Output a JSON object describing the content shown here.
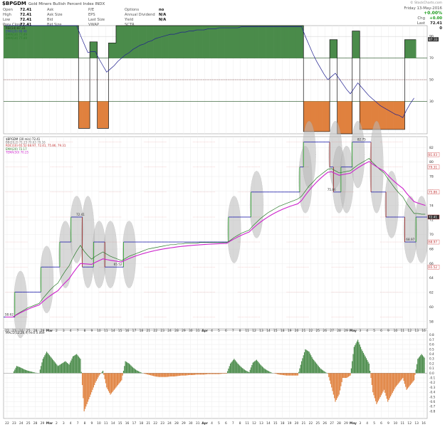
{
  "header": {
    "symbol": "$BPGDM",
    "name": "Gold Miners Bullish Percent Index  INDX",
    "copyright": "© StockCharts.com",
    "date": "Friday 13-May-2016",
    "change_pct": "+0.00%",
    "col1": [
      {
        "k": "Open",
        "v": "72.41"
      },
      {
        "k": "High",
        "v": "72.41"
      },
      {
        "k": "Low",
        "v": "72.41"
      },
      {
        "k": "Prev Close",
        "v": "72.41"
      }
    ],
    "col2": [
      {
        "k": "Ask",
        "v": ""
      },
      {
        "k": "Ask Size",
        "v": ""
      },
      {
        "k": "Bid",
        "v": ""
      },
      {
        "k": "Bid Size",
        "v": ""
      }
    ],
    "col3": [
      {
        "k": "P/E",
        "v": ""
      },
      {
        "k": "EPS",
        "v": ""
      },
      {
        "k": "Last Size",
        "v": ""
      },
      {
        "k": "VWAP",
        "v": ""
      }
    ],
    "col4": [
      {
        "k": "Options",
        "v": "no"
      },
      {
        "k": "Annual Dividend",
        "v": "N/A"
      },
      {
        "k": "Yield",
        "v": "N/A"
      },
      {
        "k": "SCTR",
        "v": ""
      }
    ],
    "right_rows": [
      {
        "k": "Chg",
        "v": "+0.00"
      },
      {
        "k": "Last",
        "v": "72.41"
      },
      {
        "k": "Volume",
        "v": "0"
      }
    ]
  },
  "chart_data": [
    {
      "type": "area",
      "panel": "RSI",
      "legend": [
        "RSI(14) 87.33",
        "EMA(20) 66.48",
        "BMA(14) 77.49",
        "BMA(14) 77.49"
      ],
      "ylim": [
        0,
        100
      ],
      "ticks": [
        90,
        70,
        50,
        30
      ],
      "tick_labels": [
        "90",
        "70",
        "50",
        "30"
      ],
      "badge": "87.33",
      "rsi": [
        100,
        100,
        100,
        100,
        100,
        100,
        100,
        100,
        100,
        100,
        100,
        100,
        100,
        100,
        100,
        100,
        100,
        100,
        100,
        100,
        5,
        5,
        5,
        85,
        85,
        5,
        5,
        5,
        84,
        84,
        100,
        100,
        100,
        100,
        100,
        100,
        100,
        100,
        100,
        100,
        100,
        100,
        100,
        100,
        100,
        100,
        100,
        100,
        100,
        100,
        100,
        100,
        100,
        100,
        100,
        100,
        100,
        100,
        100,
        100,
        100,
        100,
        100,
        100,
        100,
        100,
        100,
        100,
        100,
        100,
        100,
        100,
        100,
        100,
        100,
        100,
        100,
        100,
        100,
        100,
        2,
        2,
        2,
        2,
        2,
        2,
        2,
        87,
        87,
        0,
        0,
        0,
        0,
        95,
        95,
        4,
        4,
        4,
        4,
        4,
        4,
        4,
        4,
        4,
        4,
        4,
        4,
        87,
        87,
        87
      ],
      "ema": [
        100,
        100,
        100,
        100,
        100,
        100,
        100,
        100,
        100,
        100,
        100,
        100,
        100,
        100,
        100,
        100,
        100,
        100,
        100,
        100,
        91,
        83,
        75,
        76,
        76,
        69,
        63,
        57,
        60,
        63,
        67,
        70,
        73,
        75,
        78,
        80,
        82,
        83,
        85,
        86,
        88,
        89,
        90,
        91,
        92,
        92,
        93,
        94,
        94,
        95,
        95,
        96,
        96,
        96,
        97,
        97,
        97,
        98,
        98,
        98,
        98,
        98,
        98,
        99,
        99,
        99,
        99,
        99,
        99,
        99,
        99,
        99,
        99,
        99,
        99,
        99,
        99,
        99,
        99,
        99,
        90,
        82,
        74,
        67,
        61,
        55,
        50,
        53,
        56,
        51,
        46,
        41,
        37,
        42,
        47,
        43,
        39,
        35,
        32,
        29,
        26,
        24,
        22,
        20,
        18,
        17,
        15,
        22,
        28,
        33
      ]
    },
    {
      "type": "line",
      "panel": "price",
      "legend": [
        "$BPGDM (30 min) 72.41",
        "BB(20,2) 71.23 70.63 79.16",
        "ROC(10) 65.52 68.97, 72.41, 75.86, 79.31",
        "EMA(20) 72.17",
        "TEMA(50) 70.25"
      ],
      "ylim": [
        57,
        83.5
      ],
      "ticks": [
        82,
        80,
        78,
        76,
        74,
        72,
        70,
        68,
        66,
        64,
        62,
        60,
        58
      ],
      "tick_labels": [
        "82",
        "80",
        "78",
        "76",
        "74",
        "72",
        "70",
        "68",
        "66",
        "64",
        "62",
        "60",
        "58"
      ],
      "right_labels": [
        {
          "y": 81.03,
          "text": "81.03"
        },
        {
          "y": 79.31,
          "text": "79.31"
        },
        {
          "y": 75.86,
          "text": "75.86"
        },
        {
          "y": 72.41,
          "text": "72.41"
        },
        {
          "y": 68.97,
          "text": "68.97"
        },
        {
          "y": 65.52,
          "text": "65.52"
        }
      ],
      "annotations": [
        {
          "i": 1,
          "y": 58.62,
          "text": "58.62"
        },
        {
          "i": 20,
          "y": 72.41,
          "text": "72.41"
        },
        {
          "i": 30,
          "y": 65.52,
          "text": "65.52"
        },
        {
          "i": 87,
          "y": 75.86,
          "text": "75.86"
        },
        {
          "i": 95,
          "y": 82.75,
          "text": "82.75"
        },
        {
          "i": 108,
          "y": 68.97,
          "text": "68.97"
        }
      ],
      "close": [
        58.62,
        58.62,
        58.62,
        62.07,
        62.07,
        62.07,
        62.07,
        62.07,
        62.07,
        62.07,
        65.52,
        65.52,
        65.52,
        65.52,
        65.52,
        68.97,
        68.97,
        68.97,
        72.41,
        72.41,
        72.41,
        65.52,
        65.52,
        65.52,
        68.97,
        68.97,
        68.97,
        65.52,
        65.52,
        65.52,
        65.52,
        65.52,
        68.97,
        68.97,
        68.97,
        68.97,
        68.97,
        68.97,
        68.97,
        68.97,
        68.97,
        68.97,
        68.97,
        68.97,
        68.97,
        68.97,
        68.97,
        68.97,
        68.97,
        68.97,
        68.97,
        68.97,
        68.97,
        68.97,
        68.97,
        68.97,
        68.97,
        68.97,
        68.97,
        68.97,
        72.41,
        72.41,
        72.41,
        72.41,
        72.41,
        72.41,
        75.86,
        75.86,
        75.86,
        75.86,
        75.86,
        75.86,
        75.86,
        75.86,
        75.86,
        75.86,
        75.86,
        75.86,
        75.86,
        79.31,
        82.75,
        82.75,
        82.75,
        82.75,
        82.75,
        82.75,
        82.75,
        79.31,
        75.86,
        75.86,
        79.31,
        79.31,
        79.31,
        82.75,
        82.75,
        82.75,
        82.75,
        82.75,
        75.86,
        75.86,
        75.86,
        75.86,
        72.41,
        72.41,
        72.41,
        72.41,
        72.41,
        68.97,
        68.97,
        68.97,
        72.41,
        72.41,
        72.41
      ],
      "ema": [
        58.62,
        58.62,
        58.62,
        59.0,
        59.3,
        59.6,
        59.9,
        60.1,
        60.3,
        60.5,
        61.2,
        61.8,
        62.4,
        62.9,
        63.3,
        64.2,
        65.0,
        65.7,
        66.8,
        67.7,
        68.5,
        67.7,
        67.1,
        66.6,
        67.0,
        67.3,
        67.6,
        67.3,
        67.0,
        66.8,
        66.6,
        66.4,
        66.7,
        67.0,
        67.2,
        67.4,
        67.6,
        67.8,
        68.0,
        68.1,
        68.2,
        68.3,
        68.4,
        68.5,
        68.6,
        68.6,
        68.7,
        68.7,
        68.8,
        68.8,
        68.8,
        68.8,
        68.9,
        68.9,
        68.9,
        68.9,
        68.9,
        68.9,
        68.9,
        68.9,
        69.2,
        69.6,
        69.9,
        70.2,
        70.4,
        70.6,
        71.2,
        71.7,
        72.2,
        72.6,
        73.0,
        73.3,
        73.6,
        73.9,
        74.1,
        74.3,
        74.5,
        74.7,
        74.9,
        75.3,
        76.0,
        76.7,
        77.2,
        77.8,
        78.2,
        78.6,
        79.0,
        79.1,
        78.8,
        78.5,
        78.6,
        78.7,
        78.8,
        79.2,
        79.6,
        79.9,
        80.2,
        80.5,
        79.9,
        79.4,
        78.9,
        78.5,
        77.7,
        77.0,
        76.3,
        75.7,
        75.2,
        74.3,
        73.6,
        72.9,
        72.9,
        72.8,
        72.8
      ]
    },
    {
      "type": "bar",
      "panel": "MACD",
      "legend": [
        "MACD(12,26,9) Hist 0.069"
      ],
      "ylim": [
        -0.95,
        0.9
      ],
      "ticks": [
        0.8,
        0.7,
        0.6,
        0.5,
        0.4,
        0.3,
        0.2,
        0.1,
        0.0,
        -0.1,
        -0.2,
        -0.3,
        -0.4,
        -0.5,
        -0.6,
        -0.7,
        -0.8
      ],
      "tick_labels": [
        "0.8",
        "0.7",
        "0.6",
        "0.5",
        "0.4",
        "0.3",
        "0.2",
        "0.1",
        "0.0",
        "-0.1",
        "-0.2",
        "-0.3",
        "-0.4",
        "-0.5",
        "-0.6",
        "-0.7",
        "-0.8"
      ],
      "hist": [
        0.0,
        0.0,
        0.0,
        0.15,
        0.12,
        0.08,
        0.05,
        0.03,
        0.01,
        0.0,
        0.3,
        0.45,
        0.35,
        0.25,
        0.15,
        0.2,
        0.25,
        0.18,
        0.35,
        0.4,
        0.3,
        -0.8,
        -0.6,
        -0.4,
        -0.2,
        -0.05,
        0.05,
        -0.3,
        -0.45,
        -0.35,
        -0.25,
        -0.15,
        0.25,
        0.2,
        0.12,
        0.06,
        0.02,
        -0.01,
        -0.03,
        -0.05,
        -0.07,
        -0.08,
        -0.08,
        -0.08,
        -0.07,
        -0.07,
        -0.06,
        -0.05,
        -0.05,
        -0.04,
        -0.04,
        -0.03,
        -0.03,
        -0.03,
        -0.02,
        -0.02,
        -0.02,
        -0.02,
        -0.01,
        -0.01,
        0.2,
        0.3,
        0.2,
        0.12,
        0.06,
        0.02,
        0.22,
        0.28,
        0.18,
        0.1,
        0.05,
        0.01,
        -0.01,
        -0.03,
        -0.04,
        -0.05,
        -0.05,
        -0.05,
        -0.05,
        0.25,
        0.5,
        0.45,
        0.3,
        0.2,
        0.1,
        0.04,
        -0.01,
        -0.3,
        -0.6,
        -0.45,
        -0.1,
        -0.1,
        -0.05,
        0.55,
        0.7,
        0.5,
        0.35,
        0.2,
        -0.4,
        -0.65,
        -0.5,
        -0.35,
        -0.6,
        -0.45,
        -0.3,
        -0.2,
        -0.1,
        -0.35,
        -0.25,
        -0.15,
        0.3,
        0.4,
        0.3
      ]
    }
  ],
  "x_labels": [
    "22",
    "23",
    "24",
    "25",
    "28",
    "29",
    "Mar",
    "2",
    "3",
    "4",
    "7",
    "8",
    "9",
    "10",
    "11",
    "14",
    "15",
    "16",
    "17",
    "18",
    "21",
    "22",
    "23",
    "24",
    "28",
    "29",
    "30",
    "31",
    "Apr",
    "4",
    "5",
    "6",
    "7",
    "8",
    "11",
    "12",
    "13",
    "14",
    "15",
    "18",
    "19",
    "20",
    "21",
    "22",
    "25",
    "26",
    "27",
    "28",
    "29",
    "May",
    "3",
    "4",
    "5",
    "6",
    "9",
    "10",
    "11",
    "12",
    "13",
    "16"
  ],
  "colors": {
    "up": "#4a8b4a",
    "down": "#e0813e",
    "price_step_up": "#22a022",
    "price_step_down": "#1a1aaa",
    "ema": "#2a7a2a",
    "tema": "#cc22cc",
    "rsi_line": "#1f1f8f",
    "grid": "#ededed",
    "band": "#b8b8b8"
  }
}
